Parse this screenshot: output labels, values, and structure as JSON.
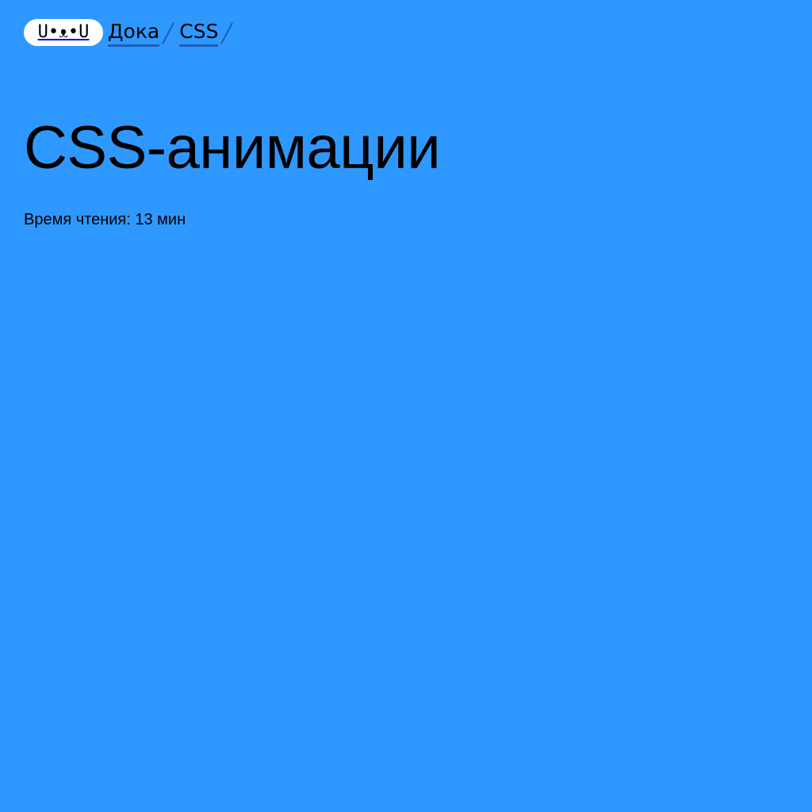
{
  "header": {
    "logo_text": "U•ᴥ•U",
    "breadcrumb": {
      "home_label": "Дока",
      "section_label": "CSS"
    }
  },
  "article": {
    "title": "CSS-анимации",
    "reading_time": "Время чтения: 13 мин"
  },
  "colors": {
    "background": "#2e98ff",
    "underline": "#1f5db8",
    "logo_bg": "#ffffff"
  }
}
